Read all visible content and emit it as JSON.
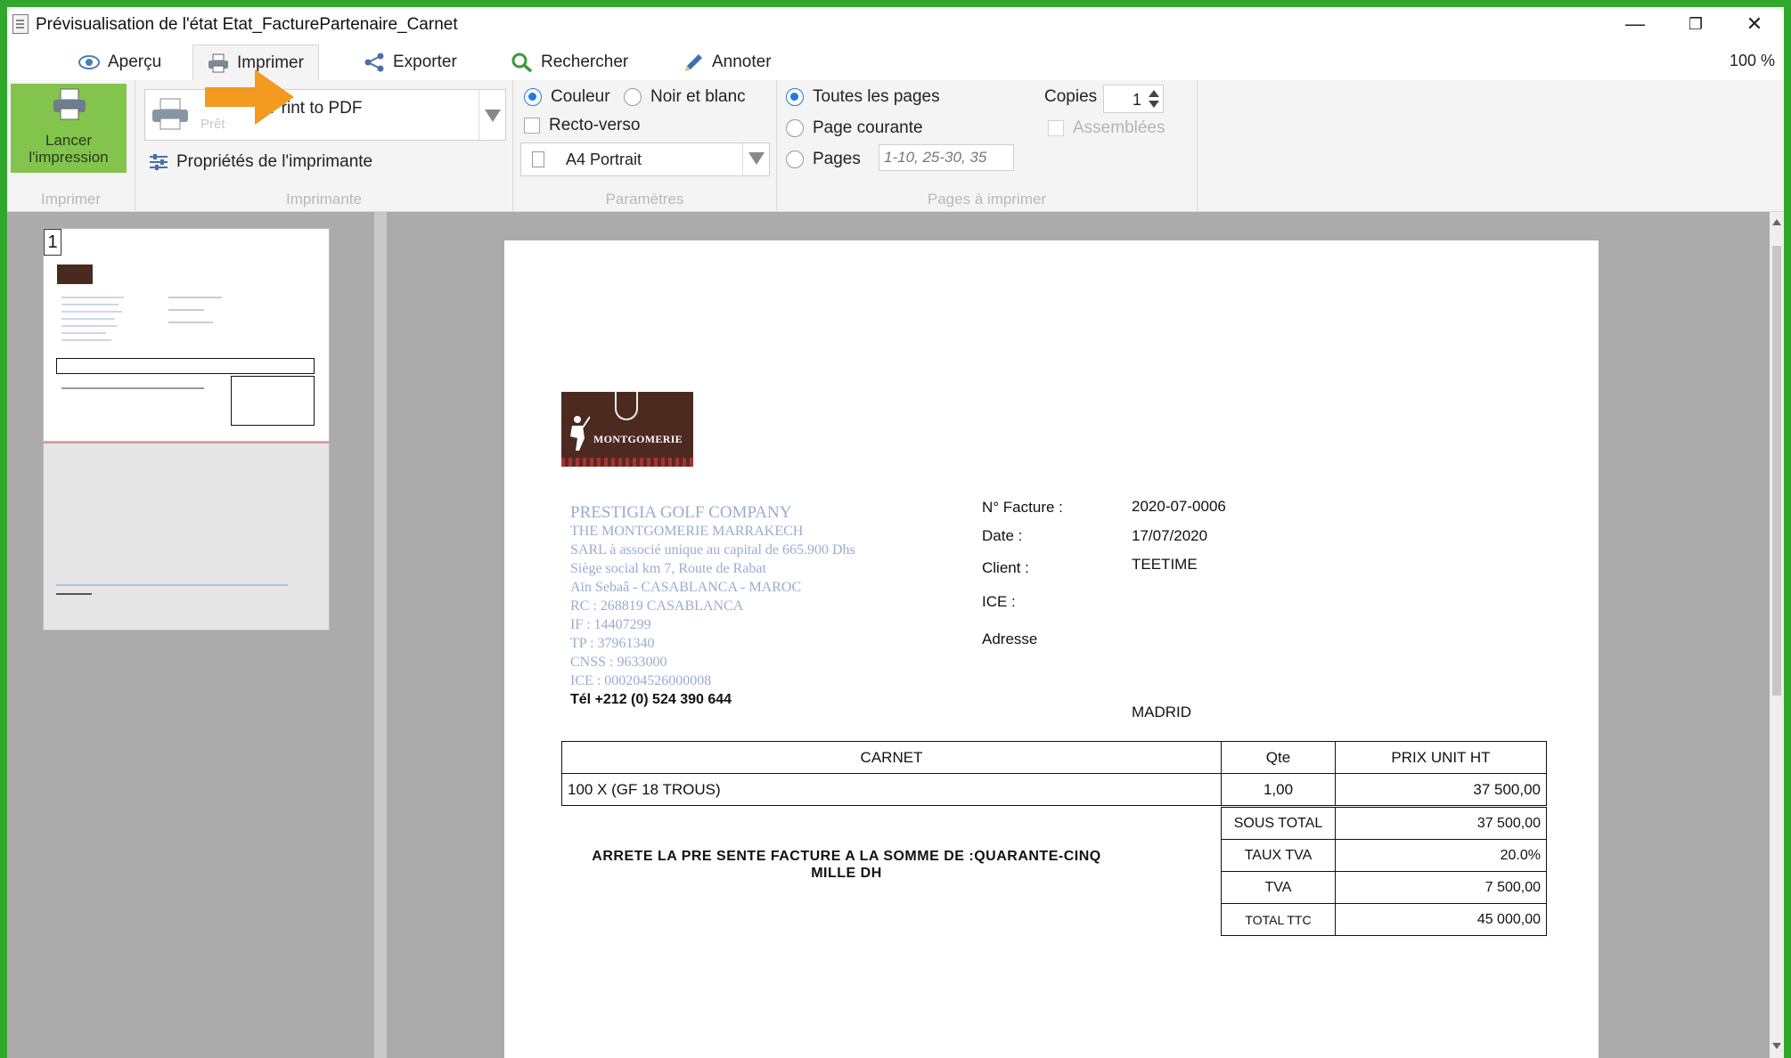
{
  "window": {
    "title": "Prévisualisation de l'état Etat_FacturePartenaire_Carnet",
    "minimize": "—",
    "maximize": "❐",
    "close": "✕"
  },
  "tabs": [
    {
      "label": "Aperçu",
      "icon": "eye-icon"
    },
    {
      "label": "Imprimer",
      "icon": "printer-icon"
    },
    {
      "label": "Exporter",
      "icon": "share-icon"
    },
    {
      "label": "Rechercher",
      "icon": "search-icon"
    },
    {
      "label": "Annoter",
      "icon": "pencil-icon"
    }
  ],
  "zoom": "100 %",
  "ribbon": {
    "print_group": {
      "button_line1": "Lancer",
      "button_line2": "l'impression",
      "label": "Imprimer"
    },
    "printer_group": {
      "printer_name": "Print to PDF",
      "printer_status": "Prêt",
      "properties": "Propriétés de l'imprimante",
      "label": "Imprimante"
    },
    "params_group": {
      "color": "Couleur",
      "bw": "Noir et blanc",
      "duplex": "Recto-verso",
      "paper": "A4 Portrait",
      "label": "Paramètres"
    },
    "pages_group": {
      "all": "Toutes les pages",
      "current": "Page courante",
      "pages": "Pages",
      "pages_placeholder": "1-10, 25-30, 35",
      "copies_label": "Copies",
      "copies_value": "1",
      "collate": "Assemblées",
      "label": "Pages à imprimer"
    }
  },
  "thumbnails": [
    {
      "number": "1"
    }
  ],
  "invoice": {
    "logo_text": "MONTGOMERIE",
    "company": {
      "name": "PRESTIGIA GOLF COMPANY",
      "lines": [
        "THE MONTGOMERIE MARRAKECH",
        "SARL à associé unique au capital de 665.900 Dhs",
        "Siège social km 7, Route de Rabat",
        "Aïn Sebaâ - CASABLANCA - MAROC",
        "RC : 268819 CASABLANCA",
        "IF : 14407299",
        "TP : 37961340",
        "CNSS : 9633000",
        "ICE : 000204526000008"
      ],
      "tel": "Tél +212 (0) 524 390 644"
    },
    "fields": {
      "facture_label": "N° Facture :",
      "facture_value": "2020-07-0006",
      "date_label": "Date :",
      "date_value": "17/07/2020",
      "client_label": "Client :",
      "client_value": "TEETIME",
      "ice_label": "ICE :",
      "adresse_label": "Adresse",
      "city": "MADRID"
    },
    "table": {
      "headers": [
        "CARNET",
        "Qte",
        "PRIX UNIT HT"
      ],
      "rows": [
        [
          "100 X (GF 18 TROUS)",
          "1,00",
          "37 500,00"
        ]
      ]
    },
    "totals": [
      {
        "label": "SOUS TOTAL",
        "value": "37 500,00"
      },
      {
        "label": "TAUX TVA",
        "value": "20.0%"
      },
      {
        "label": "TVA",
        "value": "7 500,00"
      },
      {
        "label": "TOTAL TTC",
        "value": "45 000,00"
      }
    ],
    "amount_words": "ARRETE LA PRE SENTE FACTURE A LA SOMME DE :QUARANTE-CINQ MILLE DH"
  },
  "colors": {
    "frame": "#2fa82b",
    "launch_button": "#83c44d",
    "accent_radio": "#1f7ce0",
    "company_text": "#9aaccf",
    "arrow": "#f39a21"
  }
}
